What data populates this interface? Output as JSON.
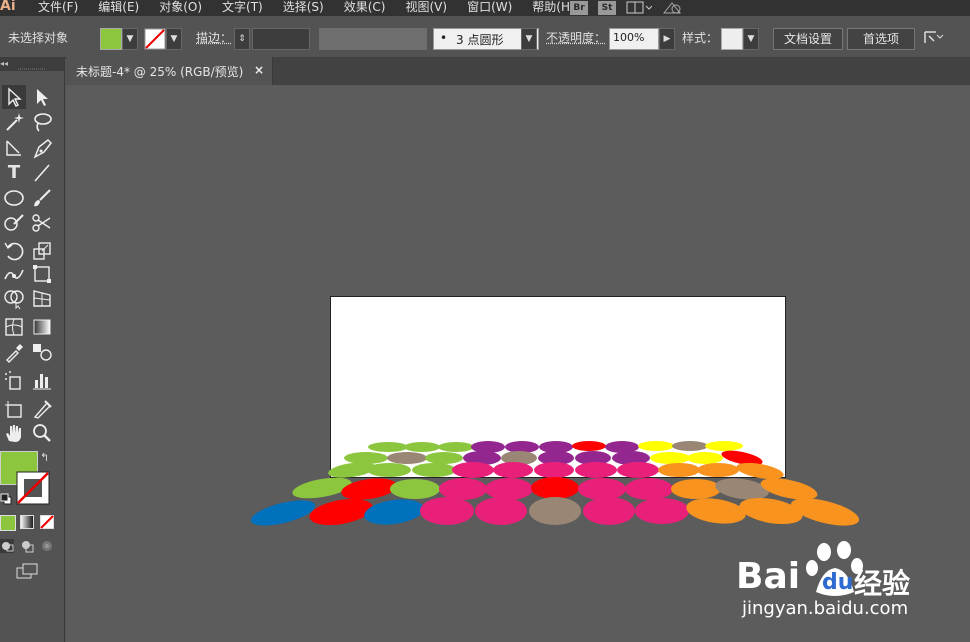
{
  "app": {
    "logo": "Ai"
  },
  "menu": {
    "items": [
      "文件(F)",
      "编辑(E)",
      "对象(O)",
      "文字(T)",
      "选择(S)",
      "效果(C)",
      "视图(V)",
      "窗口(W)",
      "帮助(H)"
    ],
    "bridge_badge": "Br",
    "stock_badge": "St"
  },
  "control": {
    "selection_status": "未选择对象",
    "fill_color": "#8cc63f",
    "stroke_label": "描边：",
    "brush_dot": "•",
    "brush_label": "3 点圆形",
    "opacity_label": "不透明度：",
    "opacity_value": "100%",
    "style_label": "样式：",
    "doc_setup_label": "文档设置",
    "preferences_label": "首选项"
  },
  "document": {
    "tab_title": "未标题-4* @ 25% (RGB/预览)",
    "close_glyph": "×"
  },
  "colors": {
    "green": "#8cc63f",
    "purple": "#93278f",
    "red": "#ff0000",
    "yellow": "#ffff00",
    "taupe": "#998675",
    "pink": "#e8207a",
    "orange": "#f7931e",
    "blue": "#0071bc"
  },
  "watermark": {
    "brand": "Bai",
    "brand_du": "du",
    "product": "经验",
    "url": "jingyan.baidu.com"
  }
}
